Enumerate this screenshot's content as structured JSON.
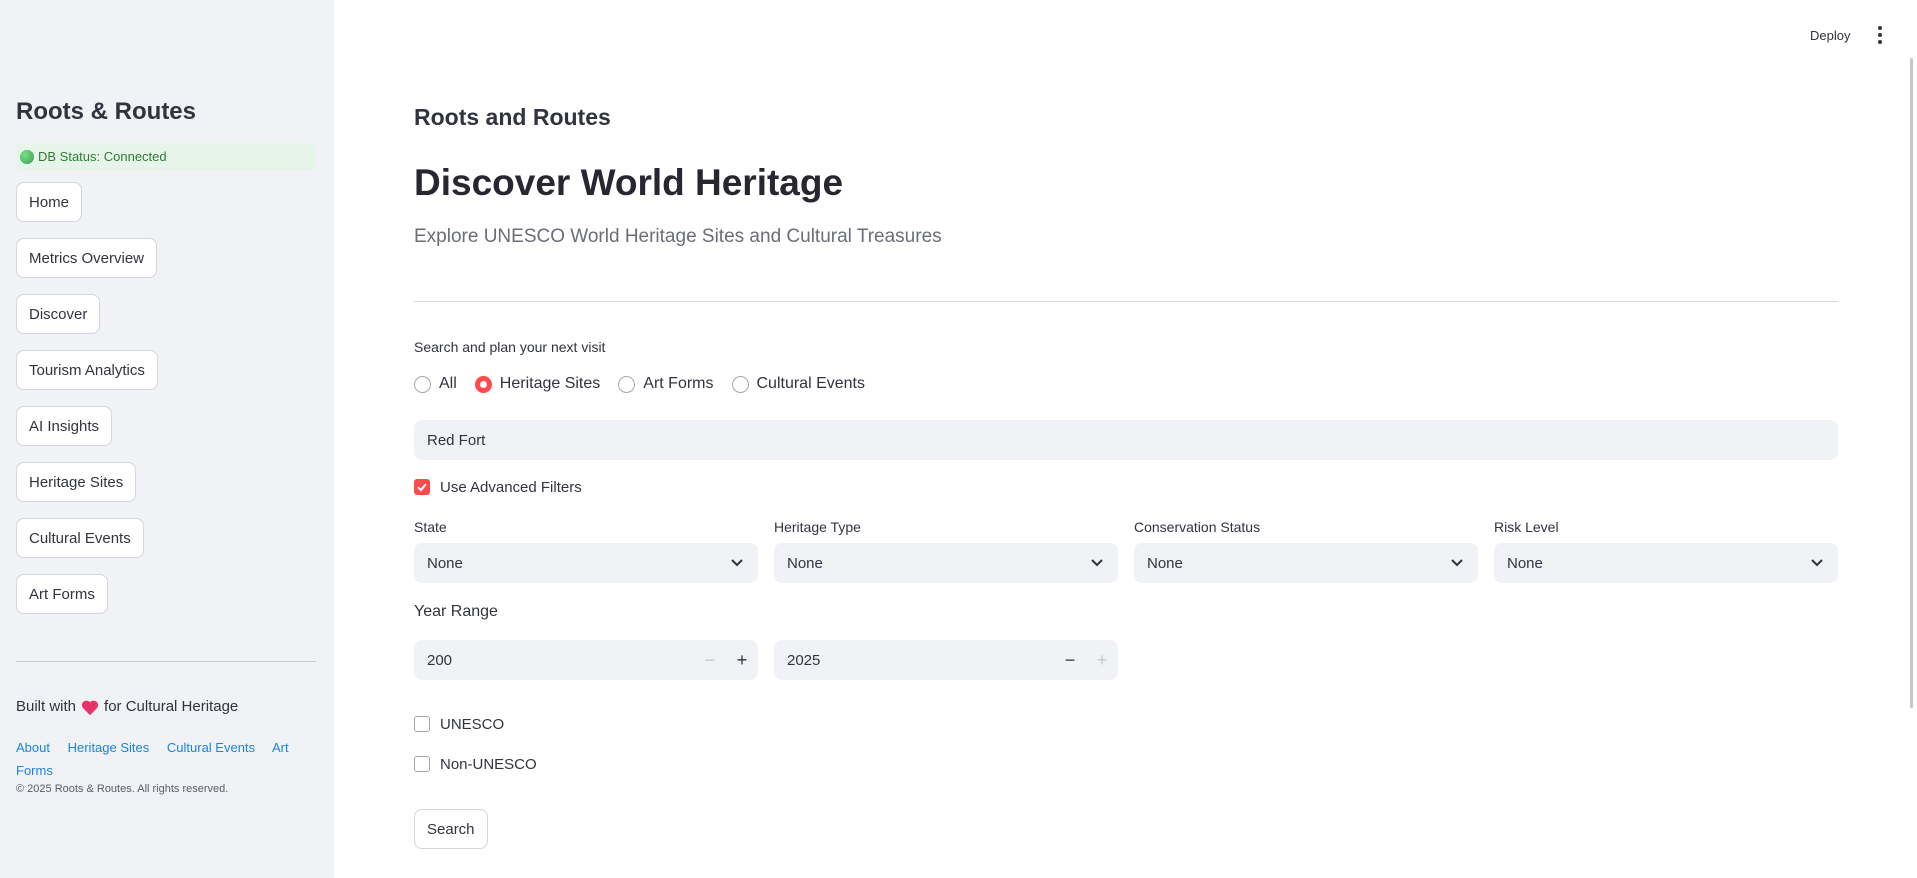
{
  "sidebar": {
    "brand": "Roots & Routes",
    "db_status": "DB Status: Connected",
    "nav": [
      "Home",
      "Metrics Overview",
      "Discover",
      "Tourism Analytics",
      "AI Insights",
      "Heritage Sites",
      "Cultural Events",
      "Art Forms"
    ],
    "built_prefix": "Built with",
    "built_suffix": "for Cultural Heritage",
    "footer_links": [
      "About",
      "Heritage Sites",
      "Cultural Events",
      "Art Forms"
    ],
    "copyright": "© 2025 Roots & Routes. All rights reserved."
  },
  "header": {
    "deploy": "Deploy",
    "menu_icon": "kebab-menu-icon"
  },
  "main": {
    "page_title": "Roots and Routes",
    "hero_title": "Discover World Heritage",
    "hero_subtitle": "Explore UNESCO World Heritage Sites and Cultural Treasures",
    "search_label": "Search and plan your next visit",
    "radio_options": [
      "All",
      "Heritage Sites",
      "Art Forms",
      "Cultural Events"
    ],
    "radio_selected": "Heritage Sites",
    "search_value": "Red Fort",
    "advanced_filters_label": "Use Advanced Filters",
    "advanced_filters_checked": true,
    "filters": [
      {
        "label": "State",
        "value": "None"
      },
      {
        "label": "Heritage Type",
        "value": "None"
      },
      {
        "label": "Conservation Status",
        "value": "None"
      },
      {
        "label": "Risk Level",
        "value": "None"
      }
    ],
    "year_range_label": "Year Range",
    "year_from": "200",
    "year_to": "2025",
    "unesco_label": "UNESCO",
    "unesco_checked": false,
    "non_unesco_label": "Non-UNESCO",
    "non_unesco_checked": false,
    "search_button": "Search"
  },
  "colors": {
    "accent": "#ff4b4b",
    "sidebar_bg": "#f0f2f6",
    "link": "#1c83e1",
    "status_green": "#2e7d32"
  }
}
